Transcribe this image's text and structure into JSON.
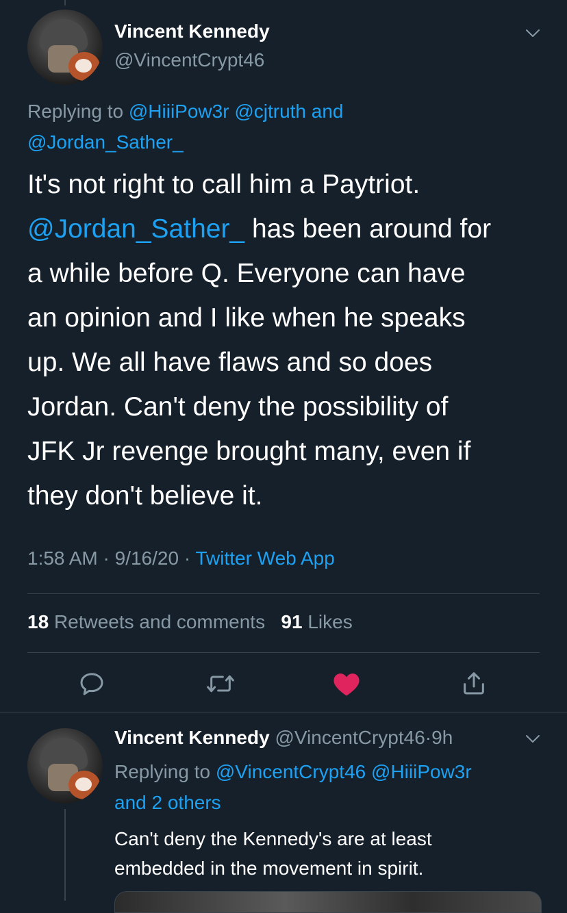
{
  "main_tweet": {
    "display_name": "Vincent Kennedy",
    "handle": "@VincentCrypt46",
    "replying_to_prefix": "Replying to",
    "replying_to_users": [
      "@HiiiPow3r",
      "@cjtruth"
    ],
    "replying_to_and": "and",
    "replying_to_last": "@Jordan_Sather_",
    "text_line1": "It's not right to call him a Paytriot.",
    "text_mention": "@Jordan_Sather_",
    "text_line2_rest": " has been around for",
    "text_lines_rest": [
      "a while before Q. Everyone can have",
      "an opinion and I like when he speaks",
      "up. We all have flaws and so does",
      "Jordan. Can't deny the possibility of",
      "JFK Jr revenge brought many, even if",
      "they don't believe it."
    ],
    "time": "1:58 AM",
    "date": "9/16/20",
    "separator": "·",
    "source": "Twitter Web App",
    "retweets_count": "18",
    "retweets_label": "Retweets and comments",
    "likes_count": "91",
    "likes_label": "Likes"
  },
  "actions": {
    "reply_icon": "reply-icon",
    "retweet_icon": "retweet-icon",
    "like_icon": "heart-icon",
    "share_icon": "share-icon",
    "like_color": "#e0245e"
  },
  "reply_tweet": {
    "display_name": "Vincent Kennedy",
    "handle": "@VincentCrypt46",
    "separator": "·",
    "age": "9h",
    "replying_to_prefix": "Replying to",
    "replying_to_user1": "@VincentCrypt46",
    "replying_to_user2": "@HiiiPow3r",
    "replying_to_others": "and 2 others",
    "text_line1": "Can't deny the Kennedy's are at least",
    "text_line2": "embedded in the movement in spirit."
  },
  "colors": {
    "background": "#15202b",
    "accent": "#1da1f2",
    "secondary_text": "#8899a6",
    "divider": "#38444d"
  }
}
